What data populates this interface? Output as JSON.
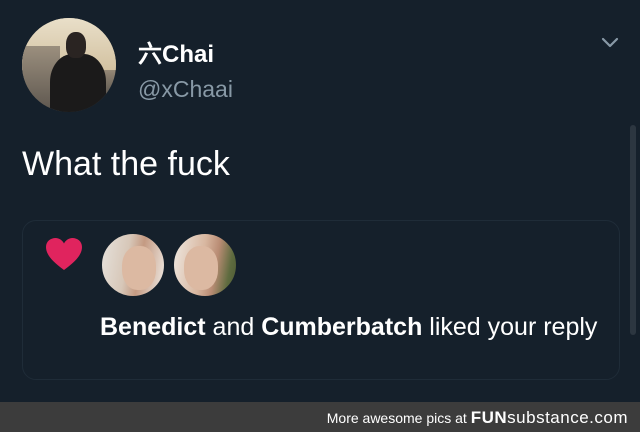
{
  "tweet": {
    "display_name": "六Chai",
    "handle": "@xChaai",
    "text": "What the fuck"
  },
  "notification": {
    "liker1": "Benedict",
    "connector": " and ",
    "liker2": "Cumberbatch",
    "action": " liked your reply",
    "heart_color": "#e0245e"
  },
  "footer": {
    "prefix": "More awesome pics at ",
    "brand_bold": "FUN",
    "brand_rest": "substance.com"
  },
  "colors": {
    "background": "#15202b",
    "secondary_text": "#8899a6",
    "footer_bg": "#3c3c3c"
  }
}
